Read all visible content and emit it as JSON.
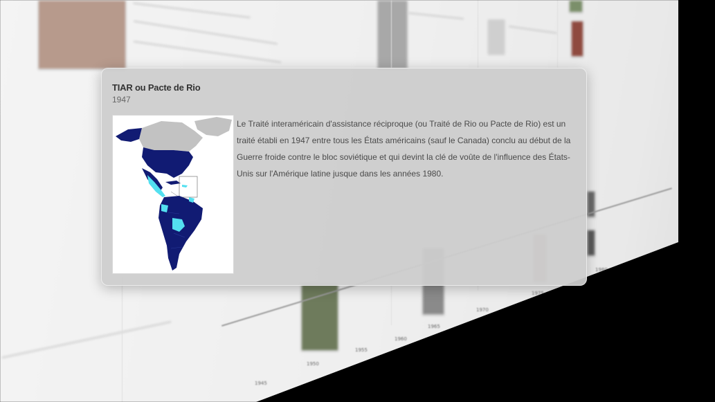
{
  "event": {
    "title": "TIAR ou Pacte de Rio",
    "date": "1947",
    "description": "Le Traité interaméricain d'assistance réciproque (ou Traité de Rio ou Pacte de Rio) est un traité établi en 1947 entre tous les États américains (sauf le Canada) conclu au début de la Guerre froide contre le bloc soviétique et qui devint la clé de voûte de l'influence des États-Unis sur l'Amérique latine jusque dans les années 1980.",
    "map_icon": "americas-map-image"
  },
  "timeline": {
    "tick_labels": [
      "1945",
      "1950",
      "1955",
      "1960",
      "1965",
      "1970",
      "1975",
      "1980"
    ]
  },
  "colors": {
    "map_member": "#111b73",
    "map_secondary": "#53e0f0",
    "map_other": "#c2c2c2",
    "popup_bg": "#cdcdcd"
  }
}
